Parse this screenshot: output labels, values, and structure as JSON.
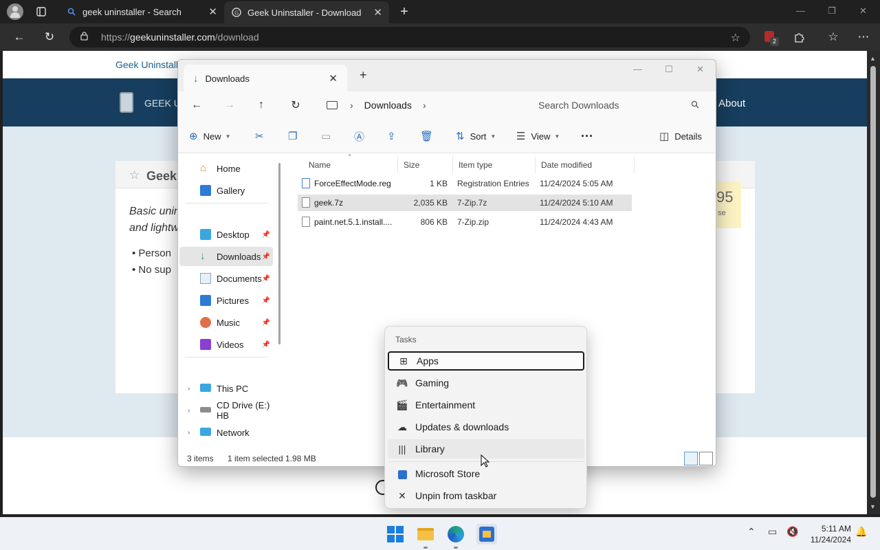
{
  "browser": {
    "tabs": [
      {
        "title": "geek uninstaller - Search"
      },
      {
        "title": "Geek Uninstaller - Download"
      }
    ],
    "url": {
      "scheme": "https://",
      "host": "geekuninstaller.com",
      "path": "/download"
    },
    "extension_badge": "2"
  },
  "webpage": {
    "top_link": "Geek Uninstall",
    "logo_text": "GEEK U",
    "nav_about": "About",
    "card_title": "Geek",
    "card_desc_line1": "Basic unin",
    "card_desc_line2": "and lightw",
    "bullet1": "• Person",
    "bullet2": "• No sup",
    "price": "95",
    "price_sub": "se"
  },
  "explorer": {
    "tab_title": "Downloads",
    "breadcrumb": "Downloads",
    "search_placeholder": "Search Downloads",
    "commands": {
      "new": "New",
      "sort": "Sort",
      "view": "View",
      "details": "Details"
    },
    "nav": {
      "home": "Home",
      "gallery": "Gallery",
      "desktop": "Desktop",
      "downloads": "Downloads",
      "documents": "Documents",
      "pictures": "Pictures",
      "music": "Music",
      "videos": "Videos",
      "this_pc": "This PC",
      "cd_drive": "CD Drive (E:) HB",
      "network": "Network"
    },
    "columns": {
      "name": "Name",
      "size": "Size",
      "type": "Item type",
      "date": "Date modified"
    },
    "files": [
      {
        "name": "ForceEffectMode.reg",
        "size": "1 KB",
        "type": "Registration Entries",
        "date": "11/24/2024 5:05 AM"
      },
      {
        "name": "geek.7z",
        "size": "2,035 KB",
        "type": "7-Zip.7z",
        "date": "11/24/2024 5:10 AM"
      },
      {
        "name": "paint.net.5.1.install....",
        "size": "806 KB",
        "type": "7-Zip.zip",
        "date": "11/24/2024 4:43 AM"
      }
    ],
    "status": {
      "count": "3 items",
      "selection": "1 item selected  1.98 MB"
    }
  },
  "jumplist": {
    "header": "Tasks",
    "items": {
      "apps": "Apps",
      "gaming": "Gaming",
      "entertainment": "Entertainment",
      "updates": "Updates & downloads",
      "library": "Library",
      "store": "Microsoft Store",
      "unpin": "Unpin from taskbar"
    }
  },
  "taskbar": {
    "time": "5:11 AM",
    "date": "11/24/2024"
  }
}
